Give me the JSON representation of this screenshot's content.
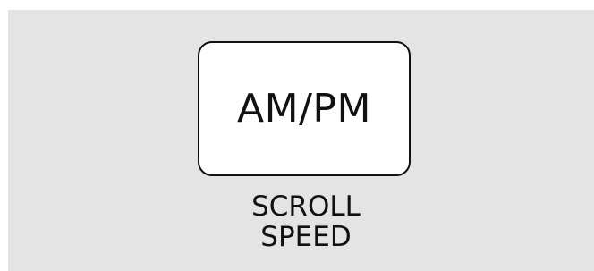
{
  "key": {
    "label": "AM/PM"
  },
  "caption": {
    "line1": "SCROLL",
    "line2": "SPEED"
  },
  "colors": {
    "background": "#e4e4e4",
    "key_fill": "#ffffff",
    "ink": "#111111"
  }
}
